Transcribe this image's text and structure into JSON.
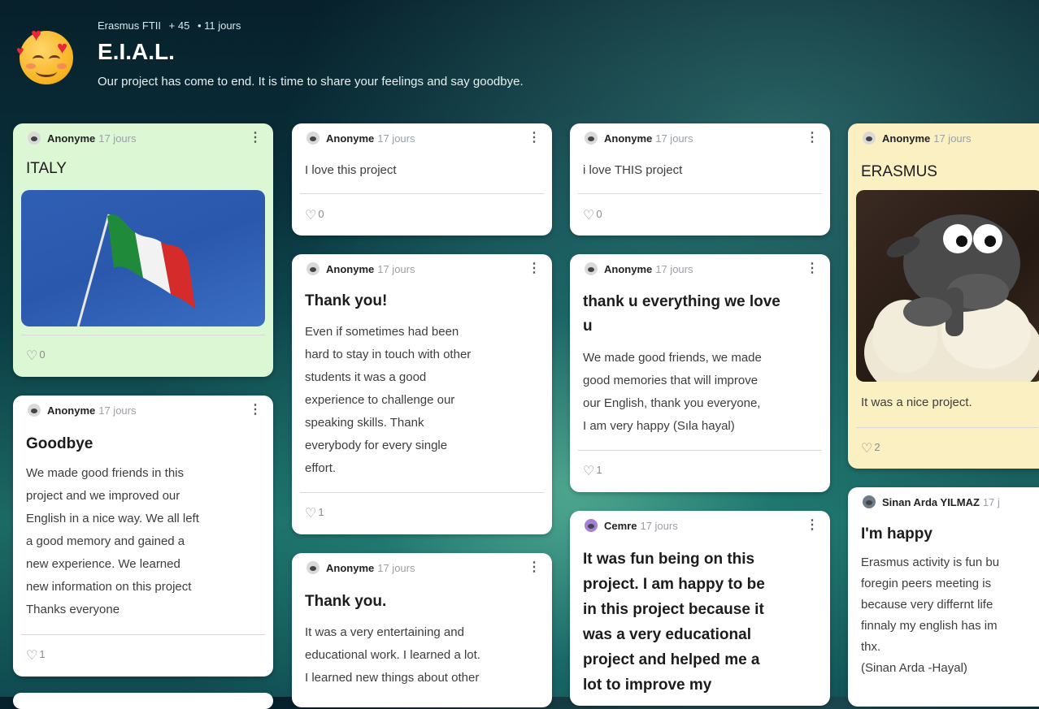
{
  "board": {
    "author": "Erasmus FTII",
    "contributors": "+ 45",
    "age": "• 11 jours",
    "title": "E.I.A.L.",
    "description": "Our project has come to end. It is time to share your feelings and say goodbye."
  },
  "colors": {
    "green_card": "#dcf7d4",
    "yellow_card": "#fbf0c2",
    "white_card": "#ffffff"
  },
  "posts": {
    "italy": {
      "author": "Anonyme",
      "time": "17 jours",
      "title": "ITALY",
      "likes": "0"
    },
    "goodbye": {
      "author": "Anonyme",
      "time": "17 jours",
      "title": "Goodbye",
      "lines": [
        "We made good friends in this",
        "project and we improved our",
        "English in a nice way. We all left",
        "a good memory and gained a",
        "new experience. We learned",
        "new information on this project",
        "Thanks everyone"
      ],
      "likes": "1"
    },
    "love1": {
      "author": "Anonyme",
      "time": "17 jours",
      "text": "I love this project",
      "likes": "0"
    },
    "thankyou": {
      "author": "Anonyme",
      "time": "17 jours",
      "title": "Thank you!",
      "lines": [
        "Even if sometimes had been",
        "hard to stay in touch with other",
        "students it was a good",
        "experience to challenge our",
        "speaking skills. Thank",
        "everybody for every single",
        "effort."
      ],
      "likes": "1"
    },
    "thankyou2": {
      "author": "Anonyme",
      "time": "17 jours",
      "title": "Thank you.",
      "lines": [
        "It was a very entertaining and",
        "educational work. I learned a lot.",
        "I learned new things about other"
      ]
    },
    "love2": {
      "author": "Anonyme",
      "time": "17 jours",
      "text": "i love THIS project",
      "likes": "0"
    },
    "thanku": {
      "author": "Anonyme",
      "time": "17 jours",
      "title_lines": [
        "thank u everything we love",
        "u"
      ],
      "lines": [
        "We made good friends, we made",
        "good memories that will improve",
        "our English, thank you everyone,",
        "I am very happy (Sıla hayal)"
      ],
      "likes": "1"
    },
    "cemre": {
      "author": "Cemre",
      "time": "17 jours",
      "lines": [
        "It was fun being on this",
        "project. I am happy to be",
        "in this project because it",
        "was a very educational",
        "project and helped me a",
        "lot to improve my"
      ]
    },
    "erasmus": {
      "author": "Anonyme",
      "time": "17 jours",
      "title": "ERASMUS",
      "text": "It was a nice project.",
      "likes": "2"
    },
    "sinan": {
      "author": "Sinan Arda YILMAZ",
      "time": "17 j",
      "title": "I'm happy",
      "lines": [
        "Erasmus activity is fun bu",
        "foregin peers meeting is",
        "because very differnt life",
        "finnaly my english has im",
        "thx.",
        "(Sinan Arda -Hayal)"
      ]
    }
  }
}
